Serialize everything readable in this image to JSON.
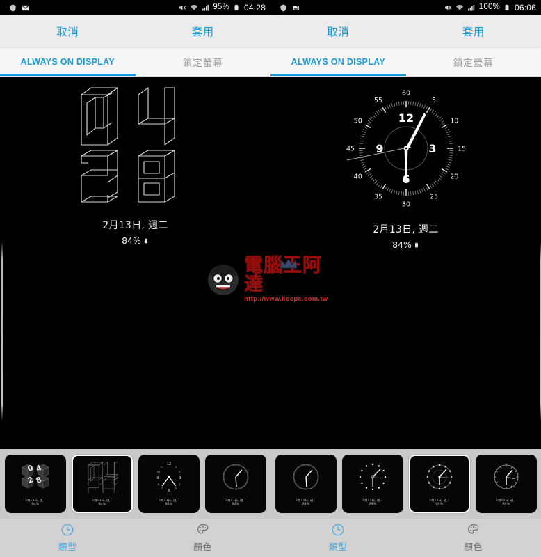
{
  "panels": [
    {
      "id": "left",
      "statusbar": {
        "left_icons": [
          "shield-icon",
          "gmail-icon"
        ],
        "right_icons": [
          "mute-icon",
          "wifi-icon",
          "signal-icon"
        ],
        "battery_percent": "95%",
        "battery_icon": "battery-icon",
        "time": "04:28"
      },
      "actionbar": {
        "cancel_label": "取消",
        "apply_label": "套用"
      },
      "tabs": [
        {
          "label": "ALWAYS ON DISPLAY",
          "active": true,
          "cjk": false
        },
        {
          "label": "鎖定螢幕",
          "active": false,
          "cjk": true
        }
      ],
      "preview": {
        "clock_style": "wireframe-digital",
        "time_hours": "04",
        "time_minutes": "28",
        "date": "2月13日, 週二",
        "battery": "84%"
      },
      "thumbnails": [
        {
          "style": "isometric-cubes",
          "selected": false,
          "date": "2月13日, 週二",
          "battery": "84%"
        },
        {
          "style": "wireframe-digital",
          "selected": true,
          "date": "2月13日, 週二",
          "battery": "84%"
        },
        {
          "style": "analog-dots",
          "selected": false,
          "date": "2月13日, 週二",
          "battery": "84%"
        },
        {
          "style": "analog-web",
          "selected": false,
          "date": "2月13日, 週二",
          "battery": "84%"
        }
      ],
      "bottom_tabs": [
        {
          "label": "類型",
          "icon": "clock-icon",
          "active": true
        },
        {
          "label": "顏色",
          "icon": "palette-icon",
          "active": false
        }
      ]
    },
    {
      "id": "right",
      "statusbar": {
        "left_icons": [
          "shield-icon",
          "photo-icon"
        ],
        "right_icons": [
          "mute-icon",
          "wifi-icon",
          "signal-icon"
        ],
        "battery_percent": "100%",
        "battery_icon": "battery-icon",
        "time": "06:06"
      },
      "actionbar": {
        "cancel_label": "取消",
        "apply_label": "套用"
      },
      "tabs": [
        {
          "label": "ALWAYS ON DISPLAY",
          "active": true,
          "cjk": false
        },
        {
          "label": "鎖定螢幕",
          "active": false,
          "cjk": true
        }
      ],
      "preview": {
        "clock_style": "analog-chronograph",
        "time_hours": "6",
        "time_minutes": "06",
        "hour_numerals": [
          "12",
          "3",
          "6",
          "9"
        ],
        "minute_numerals": [
          "60",
          "5",
          "10",
          "15",
          "20",
          "25",
          "30",
          "35",
          "40",
          "45",
          "50",
          "55"
        ],
        "date": "2月13日, 週二",
        "battery": "84%"
      },
      "thumbnails": [
        {
          "style": "analog-web",
          "selected": false,
          "date": "2月13日, 週二",
          "battery": "84%"
        },
        {
          "style": "analog-dots-thin",
          "selected": false,
          "date": "2月13日, 週二",
          "battery": "84%"
        },
        {
          "style": "analog-chronograph",
          "selected": true,
          "date": "2月13日, 週二",
          "battery": "84%"
        },
        {
          "style": "analog-plain",
          "selected": false,
          "date": "2月13日, 週二",
          "battery": "84%"
        }
      ],
      "bottom_tabs": [
        {
          "label": "類型",
          "icon": "clock-icon",
          "active": true
        },
        {
          "label": "顏色",
          "icon": "palette-icon",
          "active": false
        }
      ]
    }
  ],
  "watermark": {
    "title": "電腦王阿達",
    "url": "http://www.kocpc.com.tw"
  },
  "colors": {
    "accent": "#1a9ad7",
    "accent_bottom": "#47a9e0",
    "actionbar_bg": "#ececec",
    "tabbar_bg": "#f7f7f7",
    "strip_bg": "#c9c9c9",
    "bottombar_bg": "#d2d2d2",
    "preview_bg": "#000000",
    "watermark_red": "#cf1b1b"
  }
}
